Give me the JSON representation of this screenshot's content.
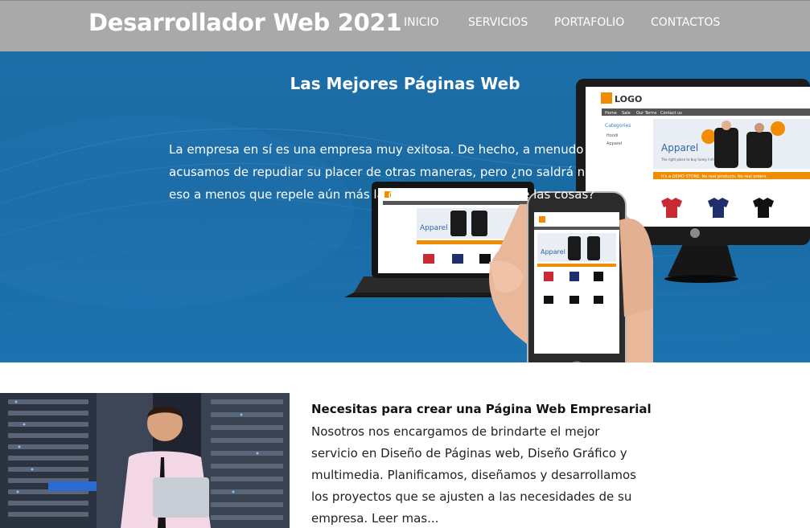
{
  "header": {
    "brand": "Desarrollador Web 2021",
    "nav": [
      "INICIO",
      "SERVICIOS",
      "PORTAFOLIO",
      "CONTACTOS"
    ]
  },
  "hero": {
    "title": "Las Mejores Páginas Web",
    "text": "La empresa en sí es una empresa muy exitosa. De hecho, a menudo nos acusamos de repudiar su placer de otras maneras, pero ¿no saldrá nada de eso a menos que repele aún más la gran elección de lo que las cosas?",
    "mockup": {
      "logo": "LOGO",
      "menu": [
        "Home",
        "Sale",
        "Our Terms",
        "Contact us"
      ],
      "categories_label": "Categories",
      "categories": [
        "Hoodi",
        "Apparel",
        "Tees"
      ],
      "banner_title": "Apparel",
      "banner_sub": "The right place to buy funny t-shirts",
      "strip": "It's a DEMO STORE. No real products. No real orders."
    }
  },
  "feature": {
    "title": "Necesitas para crear una Página Web Empresarial",
    "text": "Nosotros nos encargamos de brindarte el mejor servicio en Diseño de Páginas web, Diseño Gráfico y multimedia. Planificamos, diseñamos y desarrollamos los proyectos que se ajusten a las necesidades de su empresa. Leer mas..."
  },
  "colors": {
    "header_bg": "#a9a9a9",
    "hero_bg": "#1c6ea8",
    "accent_orange": "#f28c00"
  }
}
